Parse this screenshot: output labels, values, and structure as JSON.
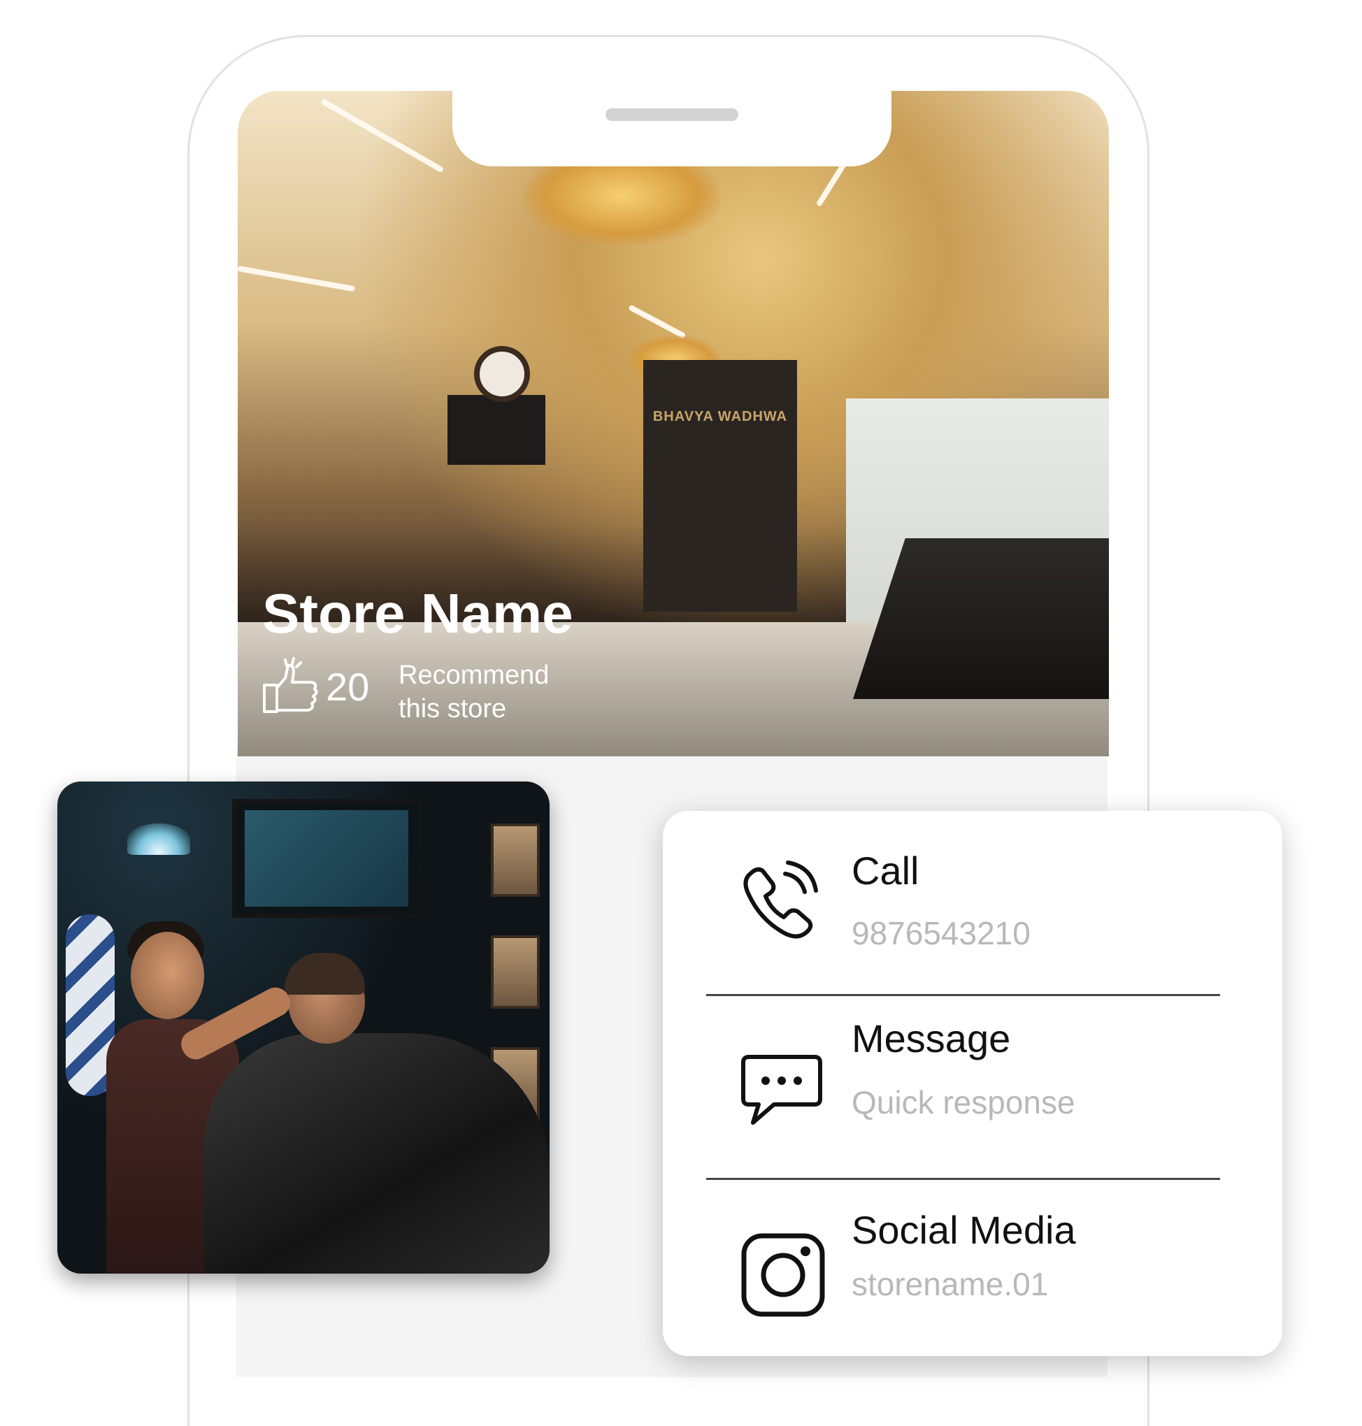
{
  "store": {
    "name": "Store Name",
    "recommend_count": "20",
    "recommend_text": "Recommend this store",
    "interior_sign": "BHAVYA WADHWA"
  },
  "contact": {
    "call": {
      "title": "Call",
      "value": "9876543210",
      "icon": "phone-call-icon"
    },
    "message": {
      "title": "Message",
      "value": "Quick response",
      "icon": "chat-bubble-icon"
    },
    "social": {
      "title": "Social Media",
      "value": "storename.01",
      "icon": "instagram-icon"
    }
  },
  "icons": {
    "recommend": "thumbs-up-icon"
  },
  "colors": {
    "text_dark": "#111111",
    "text_muted": "#b8b8b8",
    "card_bg": "#ffffff",
    "page_bg": "#ffffff"
  }
}
